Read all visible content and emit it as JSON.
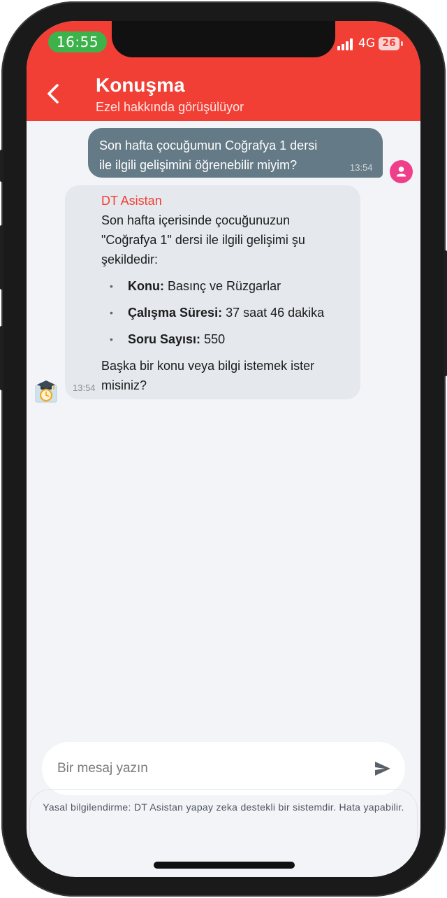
{
  "status_bar": {
    "time": "16:55",
    "network": "4G",
    "battery": "26",
    "icons": [
      "signal-icon",
      "battery-icon"
    ]
  },
  "header": {
    "title": "Konuşma",
    "subtitle": "Ezel hakkında görüşülüyor",
    "back_icon": "chevron-left-icon",
    "color": "#f23f36"
  },
  "messages": {
    "user": {
      "line1": "Son hafta çocuğumun Coğrafya 1 dersi",
      "line2": "ile ilgili gelişimini öğrenebilir miyim?",
      "time": "13:54",
      "avatar_icon": "person-icon",
      "bubble_color": "#647a86"
    },
    "bot": {
      "name": "DT Asistan",
      "intro_line1": "Son hafta içerisinde çocuğunuzun",
      "intro_line2": "\"Coğrafya 1\" dersi ile ilgili gelişimi şu",
      "intro_line3": "şekildedir:",
      "items": [
        {
          "label": "Konu:",
          "value": "Basınç ve Rüzgarlar"
        },
        {
          "label": "Çalışma Süresi:",
          "value": "37 saat 46 dakika"
        },
        {
          "label": "Soru Sayısı:",
          "value": "550"
        }
      ],
      "outro_line1": "Başka bir konu veya bilgi istemek ister",
      "outro_line2": "misiniz?",
      "time": "13:54",
      "avatar_icon": "graduation-clock-icon",
      "bubble_color": "#e5e8ed"
    }
  },
  "composer": {
    "placeholder": "Bir mesaj yazın",
    "send_icon": "send-icon"
  },
  "legal": {
    "text": "Yasal bilgilendirme: DT Asistan yapay zeka destekli bir sistemdir. Hata yapabilir."
  }
}
